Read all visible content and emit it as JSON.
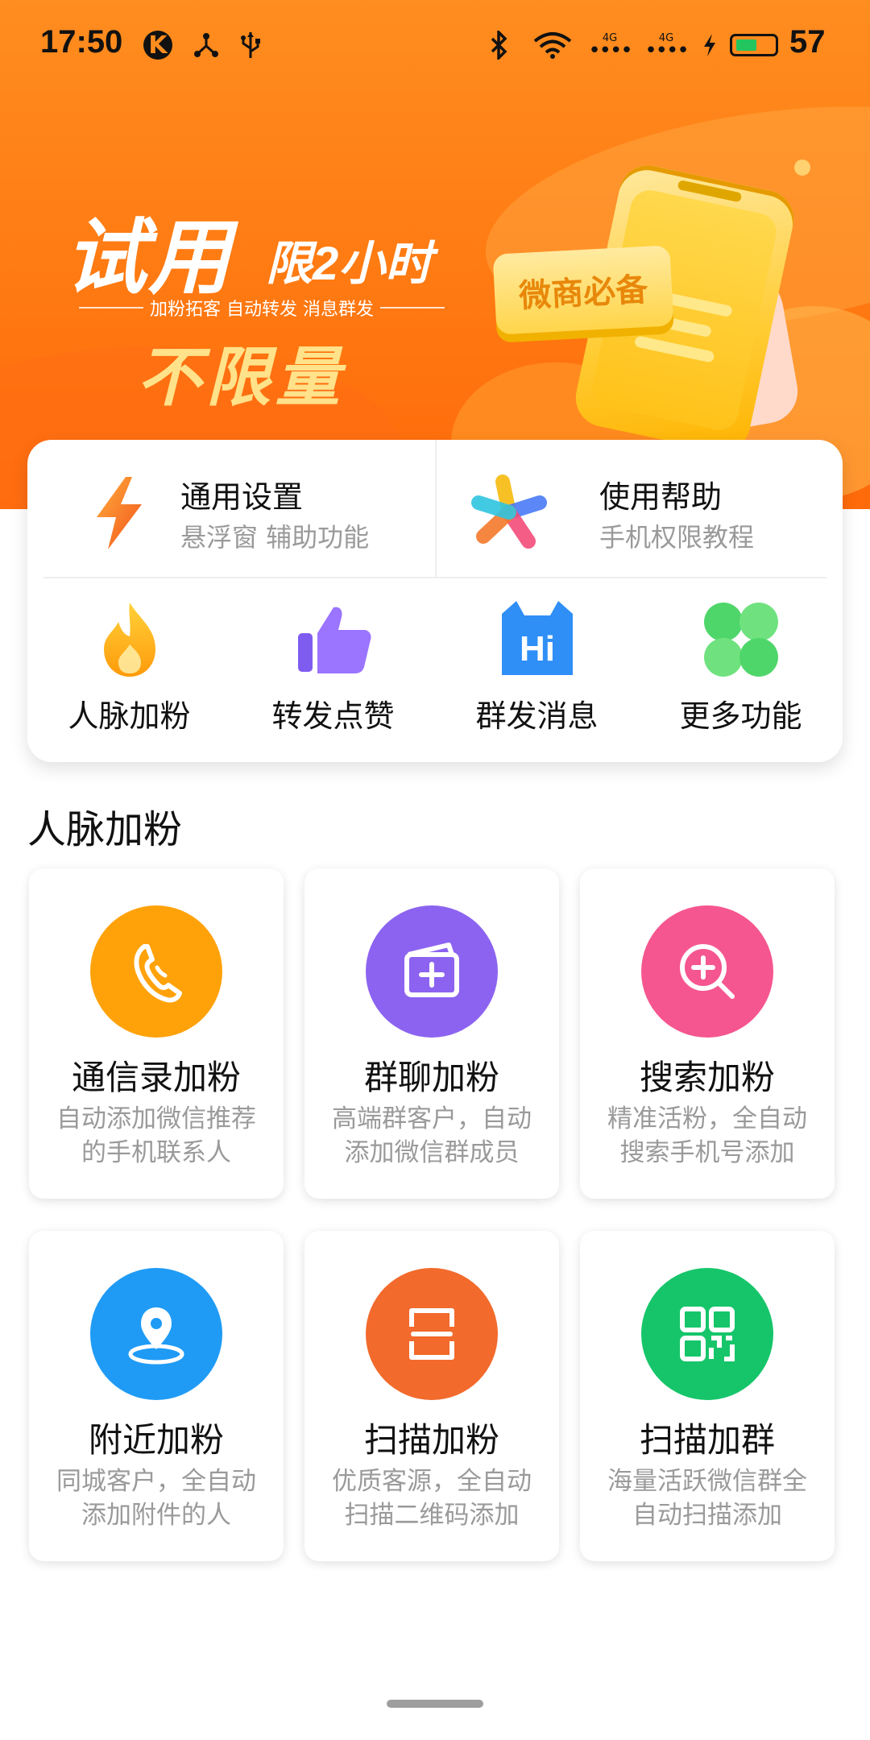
{
  "status_bar": {
    "time": "17:50",
    "k_badge": "K",
    "net_label_1": "4G",
    "net_label_2": "4G",
    "battery_level": 0.57,
    "battery_text": "57"
  },
  "banner": {
    "headline": "试用",
    "limit_text": "限2小时",
    "tagline": "加粉拓客 自动转发 消息群发",
    "unlimited": "不限量",
    "chip": "微商必备"
  },
  "quick_actions": [
    {
      "title": "通用设置",
      "subtitle": "悬浮窗 辅助功能",
      "icon": "lightning-icon"
    },
    {
      "title": "使用帮助",
      "subtitle": "手机权限教程",
      "icon": "colorful-star-icon"
    }
  ],
  "features": [
    {
      "label": "人脉加粉",
      "icon": "flame-icon"
    },
    {
      "label": "转发点赞",
      "icon": "thumbs-up-icon"
    },
    {
      "label": "群发消息",
      "icon": "hi-cat-icon"
    },
    {
      "label": "更多功能",
      "icon": "clover-icon"
    }
  ],
  "section": {
    "title": "人脉加粉",
    "cards": [
      {
        "title": "通信录加粉",
        "desc1": "自动添加微信推荐",
        "desc2": "的手机联系人",
        "icon": "phone-handset-icon",
        "color": "#ffa20a"
      },
      {
        "title": "群聊加粉",
        "desc1": "高端群客户，自动",
        "desc2": "添加微信群成员",
        "icon": "add-group-icon",
        "color": "#8c63f0"
      },
      {
        "title": "搜索加粉",
        "desc1": "精准活粉，全自动",
        "desc2": "搜索手机号添加",
        "icon": "search-plus-icon",
        "color": "#f5568f"
      },
      {
        "title": "附近加粉",
        "desc1": "同城客户，全自动",
        "desc2": "添加附件的人",
        "icon": "location-pin-icon",
        "color": "#1f9bf5"
      },
      {
        "title": "扫描加粉",
        "desc1": "优质客源，全自动",
        "desc2": "扫描二维码添加",
        "icon": "scan-frame-icon",
        "color": "#f26a2c"
      },
      {
        "title": "扫描加群",
        "desc1": "海量活跃微信群全",
        "desc2": "自动扫描添加",
        "icon": "qr-code-icon",
        "color": "#16c56a"
      }
    ]
  }
}
